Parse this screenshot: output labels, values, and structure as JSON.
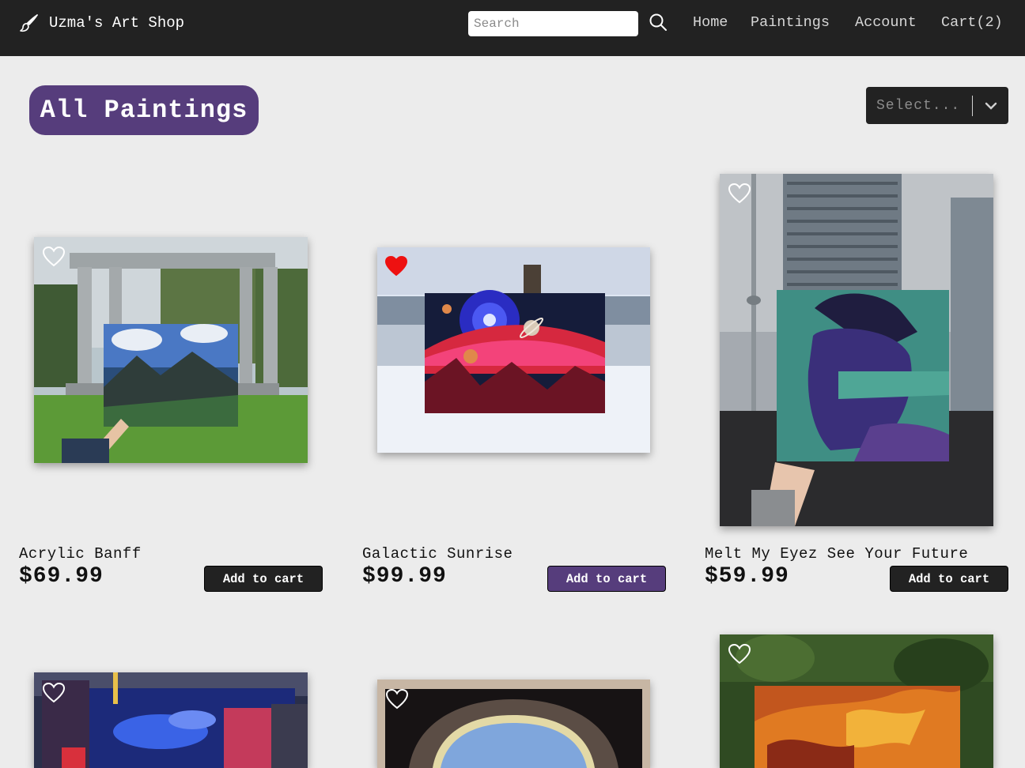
{
  "brand": {
    "name": "Uzma's Art Shop",
    "icon": "paintbrush-icon"
  },
  "search": {
    "placeholder": "Search",
    "value": "",
    "icon": "search-icon"
  },
  "nav": {
    "home": "Home",
    "paintings": "Paintings",
    "account": "Account",
    "cart": "Cart(2)"
  },
  "page": {
    "title": "All Paintings"
  },
  "sort": {
    "placeholder": "Select...",
    "icon": "chevron-down-icon"
  },
  "products": [
    {
      "title": "Acrylic Banff",
      "price": "$69.99",
      "button": "Add to cart",
      "favorited": false
    },
    {
      "title": "Galactic Sunrise",
      "price": "$99.99",
      "button": "Add to cart",
      "favorited": true
    },
    {
      "title": "Melt My Eyez See Your Future",
      "price": "$59.99",
      "button": "Add to cart",
      "favorited": false
    },
    {
      "favorited": false
    },
    {
      "favorited": false
    },
    {
      "favorited": false
    }
  ],
  "colors": {
    "navbar": "#222222",
    "accent_purple": "#563d7c",
    "background": "#ececec",
    "heart_active": "#ee1111"
  }
}
